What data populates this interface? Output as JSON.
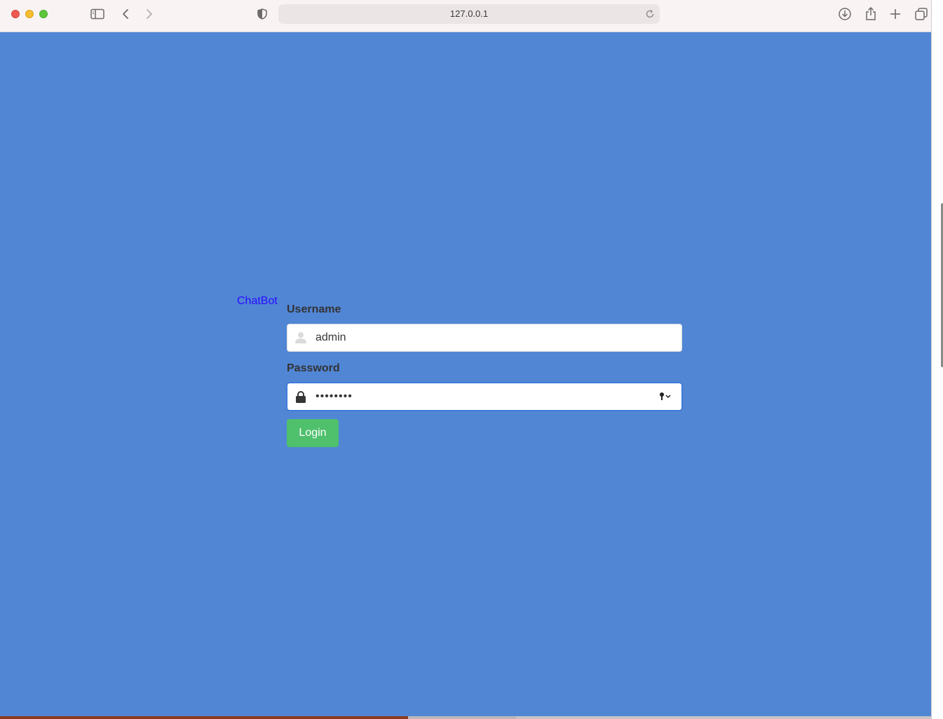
{
  "browser": {
    "url": "127.0.0.1",
    "icons": {
      "sidebar": "sidebar-icon",
      "back": "chevron-left-icon",
      "forward": "chevron-right-icon",
      "shield": "shield-icon",
      "reload": "reload-icon",
      "download": "download-icon",
      "share": "share-icon",
      "new_tab": "plus-icon",
      "tabs": "tabs-overview-icon"
    }
  },
  "page": {
    "background_color": "#5186d5",
    "brand": "ChatBot",
    "username_label": "Username",
    "username_value": "admin",
    "password_label": "Password",
    "password_value": "••••••••",
    "login_label": "Login",
    "login_color": "#4fc06c",
    "brand_color": "#2a0bff"
  }
}
